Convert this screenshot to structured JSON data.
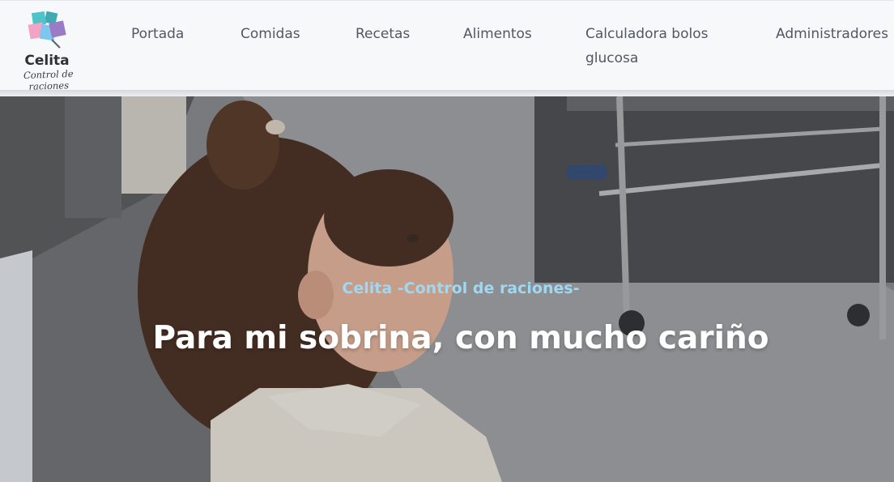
{
  "brand": {
    "name": "Celita",
    "tagline": "Control de raciones",
    "colors": {
      "teal": "#4fc3c7",
      "pink": "#f2a3c6",
      "blue": "#7ec6ee",
      "purple": "#9a7cc6"
    }
  },
  "nav": {
    "items": [
      {
        "label": "Portada"
      },
      {
        "label": "Comidas"
      },
      {
        "label": "Recetas"
      },
      {
        "label": "Alimentos"
      },
      {
        "label": "Calculadora bolos glucosa"
      },
      {
        "label": "Administradores"
      }
    ]
  },
  "hero": {
    "kicker": "Celita -Control de raciones-",
    "title": "Para mi sobrina, con mucho cariño",
    "kicker_color": "#9fd8f2"
  }
}
